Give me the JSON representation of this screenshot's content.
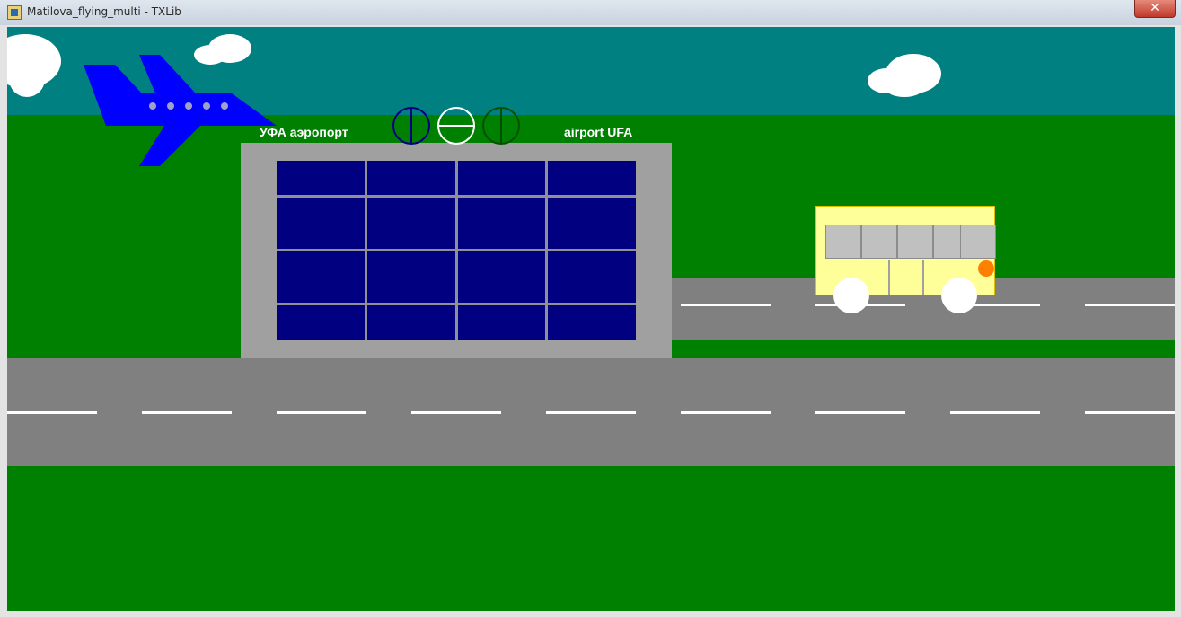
{
  "window": {
    "title": "Matilova_flying_multi - TXLib",
    "close_label": "✕"
  },
  "scene": {
    "colors": {
      "sky": "#008080",
      "grass": "#008000",
      "road": "#808080",
      "terminal_wall": "#a0a0a0",
      "glass": "#000080",
      "plane": "#0000ff",
      "bus_body": "#ffff99",
      "bus_light": "#ff8000"
    },
    "signs": {
      "left": "УФА аэропорт",
      "right": "airport UFA"
    },
    "flag_icons": [
      "circle-vertical-line-blue-icon",
      "circle-horizontal-line-white-icon",
      "circle-vertical-line-green-icon"
    ]
  }
}
